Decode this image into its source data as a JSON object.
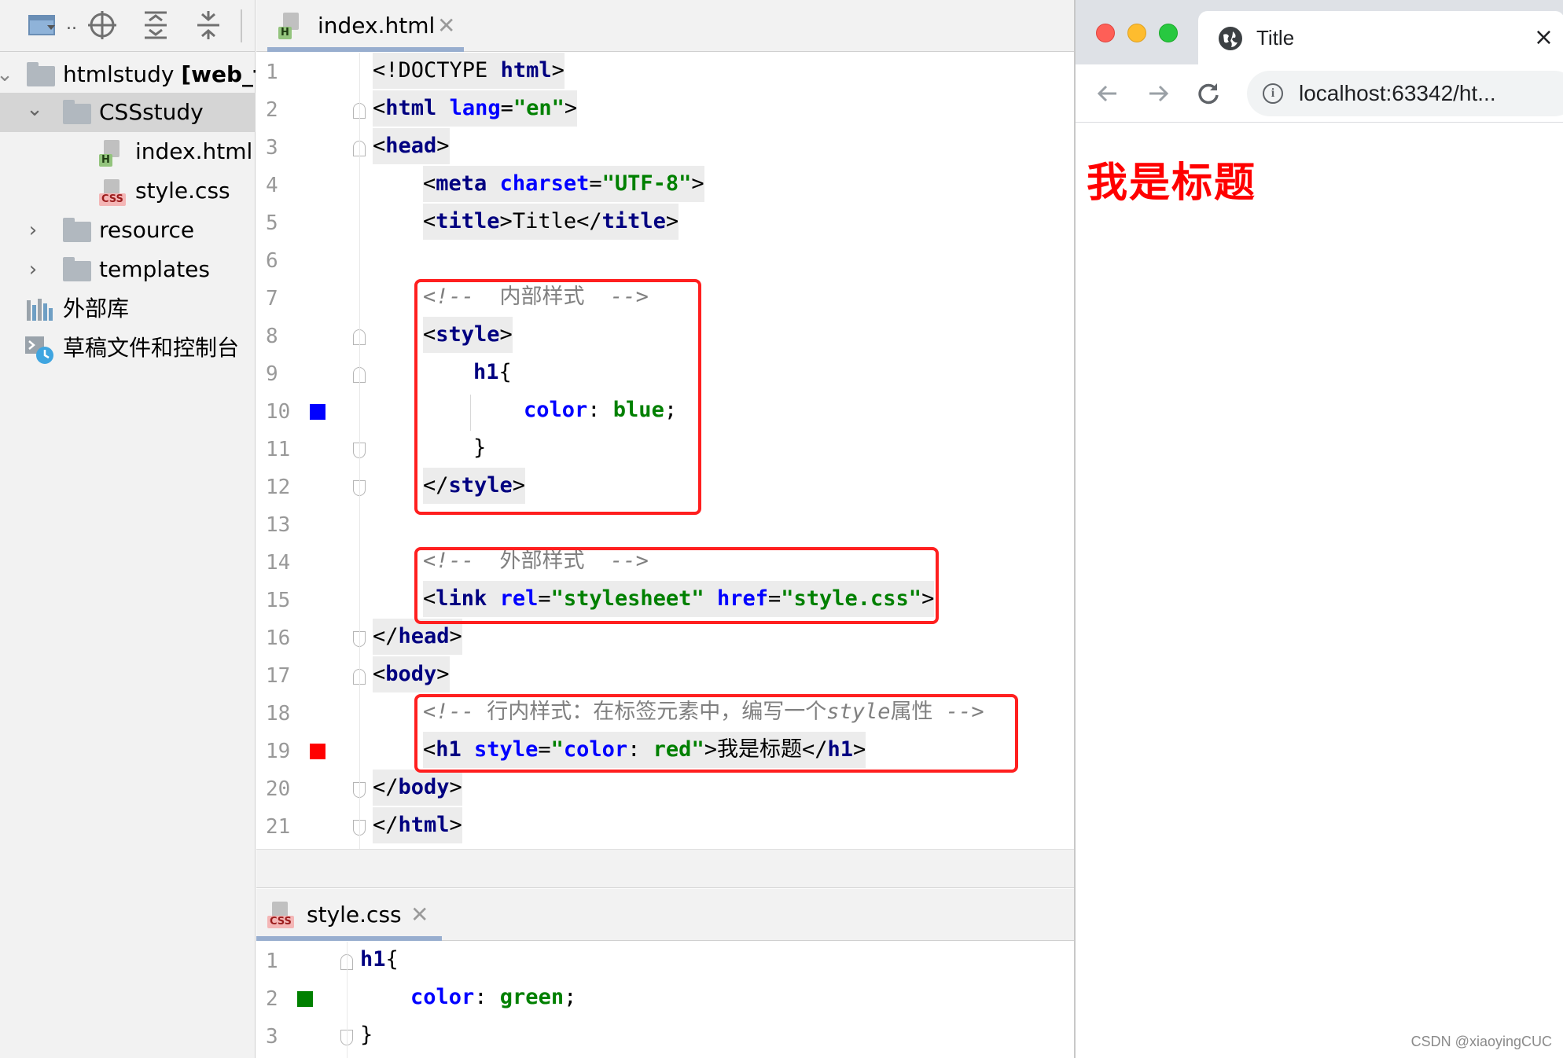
{
  "project_tree": {
    "root": {
      "name": "htmlstudy",
      "module": "[web_f"
    },
    "folder_selected": "CSSstudy",
    "files": [
      {
        "name": "index.html",
        "type_tag": "H"
      },
      {
        "name": "style.css",
        "type_tag": "CSS"
      }
    ],
    "folders": [
      "resource",
      "templates"
    ],
    "external_libs": "外部库",
    "scratches": "草稿文件和控制台",
    "toolbar_overflow": ".."
  },
  "editor_top": {
    "tab": {
      "label": "index.html",
      "type_tag": "H"
    },
    "lines": [
      "1",
      "2",
      "3",
      "4",
      "5",
      "6",
      "7",
      "8",
      "9",
      "10",
      "11",
      "12",
      "13",
      "14",
      "15",
      "16",
      "17",
      "18",
      "19",
      "20",
      "21"
    ],
    "code": {
      "l1": {
        "a": "<!DOCTYPE ",
        "b": "html",
        "c": ">"
      },
      "l2": {
        "a": "<",
        "tag": "html",
        "attr": "lang",
        "eq": "=",
        "val": "\"en\"",
        "c": ">"
      },
      "l3": {
        "a": "<",
        "tag": "head",
        "c": ">"
      },
      "l4": {
        "a": "<",
        "tag": "meta",
        "attr": "charset",
        "eq": "=",
        "val": "\"UTF-8\"",
        "c": ">"
      },
      "l5": {
        "a": "<",
        "tag": "title",
        "b": ">",
        "text": "Title",
        "c": "</",
        "tag2": "title",
        "d": ">"
      },
      "l7": {
        "open": "<!-- ",
        "text": " 内部样式 ",
        "close": " -->"
      },
      "l8": {
        "a": "<",
        "tag": "style",
        "c": ">"
      },
      "l9": {
        "sel": "h1",
        "brace": "{"
      },
      "l10": {
        "prop": "color",
        "colon": ": ",
        "val": "blue",
        "semi": ";"
      },
      "l11": {
        "brace": "}"
      },
      "l12": {
        "a": "</",
        "tag": "style",
        "c": ">"
      },
      "l14": {
        "open": "<!-- ",
        "text": " 外部样式 ",
        "close": " -->"
      },
      "l15": {
        "a": "<",
        "tag": "link",
        "attr1": "rel",
        "eq1": "=",
        "val1": "\"stylesheet\"",
        "attr2": "href",
        "eq2": "=",
        "val2": "\"style.css\"",
        "c": ">"
      },
      "l16": {
        "a": "</",
        "tag": "head",
        "c": ">"
      },
      "l17": {
        "a": "<",
        "tag": "body",
        "c": ">"
      },
      "l18": {
        "open": "<!-- ",
        "text": "行内样式：在标签元素中，编写一个",
        "kw": "style",
        "text2": "属性",
        "close": " -->"
      },
      "l19": {
        "a": "<",
        "tag": "h1",
        "attr": "style",
        "eq": "=",
        "q1": "\"",
        "prop": "color",
        "colon": ": ",
        "val": "red",
        "q2": "\"",
        "b": ">",
        "text": "我是标题",
        "c": "</",
        "tag2": "h1",
        "d": ">"
      },
      "l20": {
        "a": "</",
        "tag": "body",
        "c": ">"
      },
      "l21": {
        "a": "</",
        "tag": "html",
        "c": ">"
      }
    }
  },
  "editor_bottom": {
    "tab": {
      "label": "style.css",
      "type_tag": "CSS"
    },
    "lines": [
      "1",
      "2",
      "3"
    ],
    "code": {
      "l1": {
        "sel": "h1",
        "brace": "{"
      },
      "l2": {
        "prop": "color",
        "colon": ": ",
        "val": "green",
        "semi": ";"
      },
      "l3": {
        "brace": "}"
      }
    }
  },
  "colors": {
    "swatch_blue": "#0000ff",
    "swatch_red": "#ff0000",
    "swatch_green": "#008000",
    "annotation_red": "#ff1f1f",
    "rendered_h1": "#ff0000"
  },
  "browser": {
    "tab_title": "Title",
    "close": "×",
    "url": "localhost:63342/ht...",
    "page_h1": "我是标题"
  },
  "watermark": "CSDN @xiaoyingCUC"
}
